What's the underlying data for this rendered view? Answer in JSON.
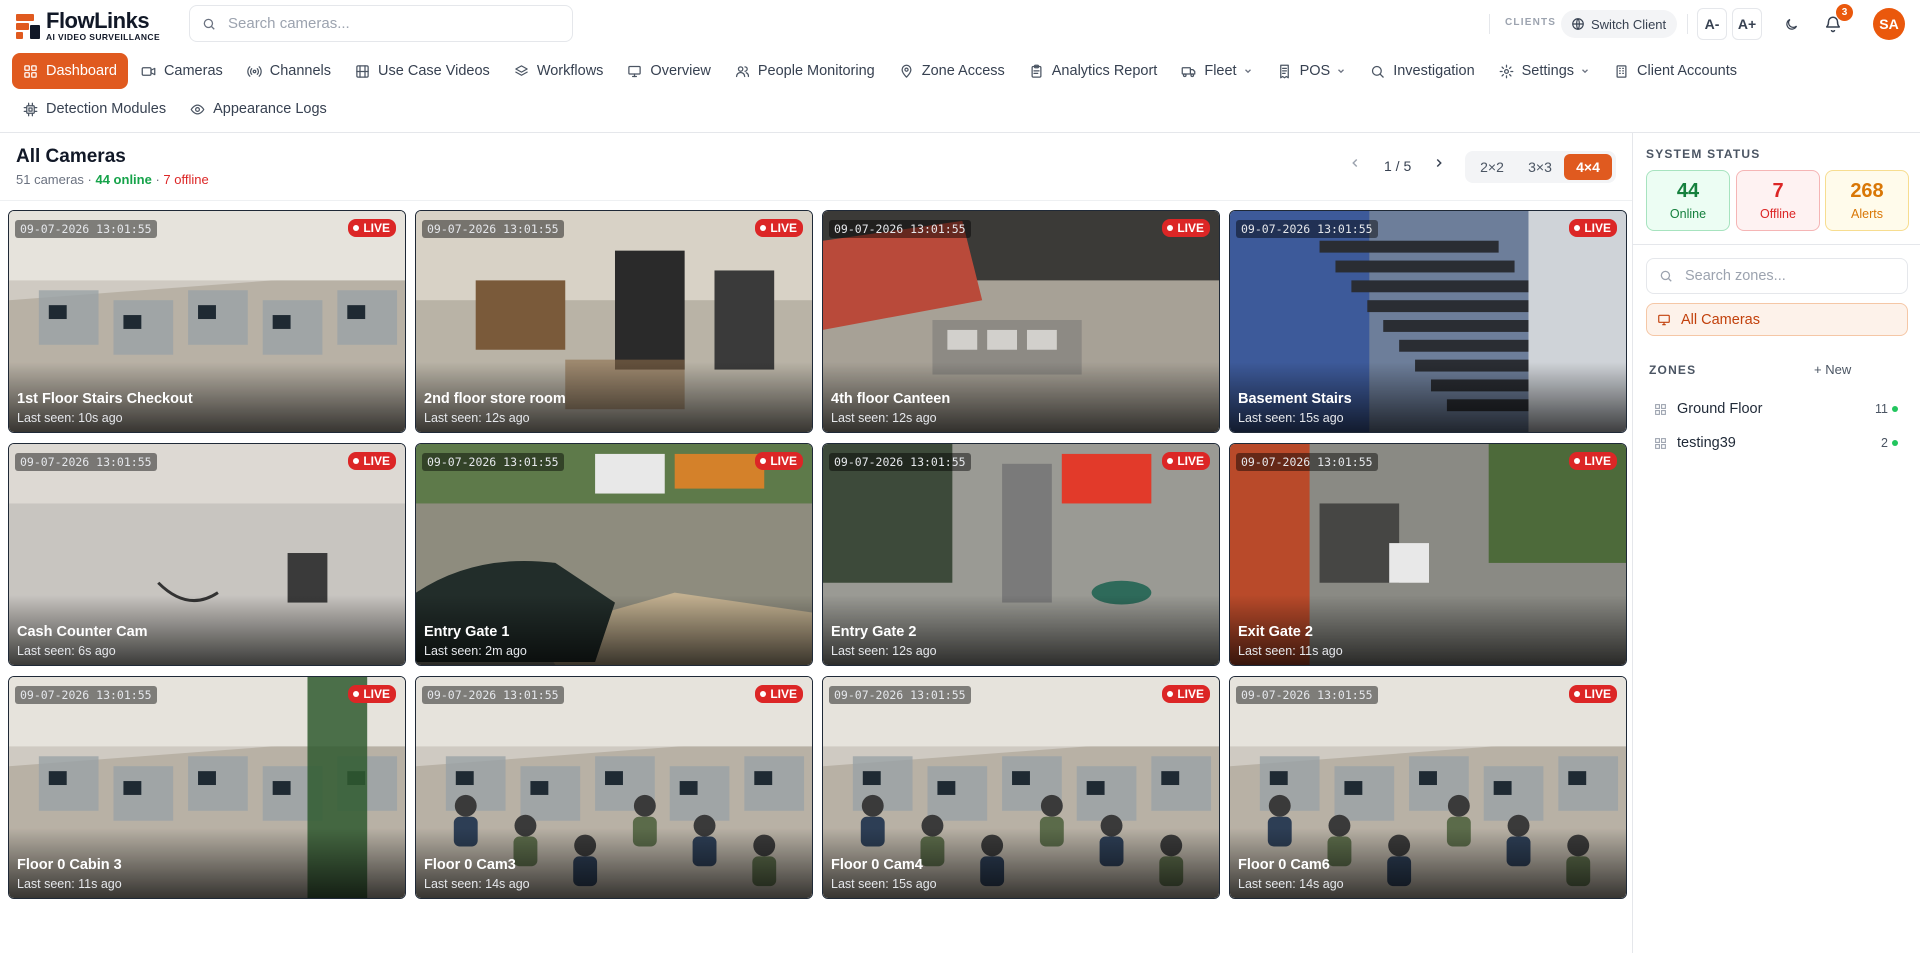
{
  "app": {
    "name": "FlowLinks",
    "tagline": "AI VIDEO SURVEILLANCE",
    "search_placeholder": "Search cameras...",
    "clients_label": "CLIENTS",
    "switch_client_label": "Switch Client",
    "font_decrease": "A-",
    "font_increase": "A+",
    "notification_count": "3",
    "user_initials": "SA",
    "accent_color": "#e05a1f"
  },
  "nav": {
    "row1": [
      {
        "label": "Dashboard",
        "icon": "grid-icon",
        "active": true
      },
      {
        "label": "Cameras",
        "icon": "video-icon"
      },
      {
        "label": "Channels",
        "icon": "broadcast-icon"
      },
      {
        "label": "Use Case Videos",
        "icon": "film-icon"
      },
      {
        "label": "Workflows",
        "icon": "layers-icon"
      },
      {
        "label": "Overview",
        "icon": "monitor-icon"
      },
      {
        "label": "People Monitoring",
        "icon": "users-icon"
      },
      {
        "label": "Zone Access",
        "icon": "map-pin-icon"
      },
      {
        "label": "Analytics Report",
        "icon": "clipboard-icon"
      },
      {
        "label": "Fleet",
        "icon": "truck-icon",
        "dropdown": true
      },
      {
        "label": "POS",
        "icon": "receipt-icon",
        "dropdown": true
      },
      {
        "label": "Investigation",
        "icon": "search-icon"
      },
      {
        "label": "Settings",
        "icon": "gear-icon",
        "dropdown": true
      },
      {
        "label": "Client Accounts",
        "icon": "building-icon"
      }
    ],
    "row2": [
      {
        "label": "Detection Modules",
        "icon": "cpu-icon"
      },
      {
        "label": "Appearance Logs",
        "icon": "eye-icon"
      }
    ]
  },
  "main": {
    "title": "All Cameras",
    "total": "51 cameras",
    "online": "44 online",
    "offline": "7 offline",
    "sep": " · ",
    "page": "1 / 5",
    "grid_options": [
      "2×2",
      "3×3",
      "4×4"
    ],
    "grid_selected": "4×4"
  },
  "cameras": [
    {
      "name": "1st Floor Stairs Checkout",
      "last_seen": "Last seen: 10s ago",
      "timestamp": "09-07-2026 13:01:55",
      "live": "LIVE",
      "scene": "office"
    },
    {
      "name": "2nd floor store room",
      "last_seen": "Last seen: 12s ago",
      "timestamp": "09-07-2026 13:01:55",
      "live": "LIVE",
      "scene": "store"
    },
    {
      "name": "4th floor Canteen",
      "last_seen": "Last seen: 12s ago",
      "timestamp": "09-07-2026 13:01:55",
      "live": "LIVE",
      "scene": "canteen"
    },
    {
      "name": "Basement Stairs",
      "last_seen": "Last seen: 15s ago",
      "timestamp": "09-07-2026 13:01:55",
      "live": "LIVE",
      "scene": "stairs"
    },
    {
      "name": "Cash Counter Cam",
      "last_seen": "Last seen: 6s ago",
      "timestamp": "09-07-2026 13:01:55",
      "live": "LIVE",
      "scene": "cash"
    },
    {
      "name": "Entry Gate 1",
      "last_seen": "Last seen: 2m ago",
      "timestamp": "09-07-2026 13:01:55",
      "live": "LIVE",
      "scene": "gate1"
    },
    {
      "name": "Entry Gate 2",
      "last_seen": "Last seen: 12s ago",
      "timestamp": "09-07-2026 13:01:55",
      "live": "LIVE",
      "scene": "gate2"
    },
    {
      "name": "Exit Gate 2",
      "last_seen": "Last seen: 11s ago",
      "timestamp": "09-07-2026 13:01:55",
      "live": "LIVE",
      "scene": "exit"
    },
    {
      "name": "Floor 0 Cabin 3",
      "last_seen": "Last seen: 11s ago",
      "timestamp": "09-07-2026 13:01:55",
      "live": "LIVE",
      "scene": "cabin"
    },
    {
      "name": "Floor 0 Cam3",
      "last_seen": "Last seen: 14s ago",
      "timestamp": "09-07-2026 13:01:55",
      "live": "LIVE",
      "scene": "people"
    },
    {
      "name": "Floor 0 Cam4",
      "last_seen": "Last seen: 15s ago",
      "timestamp": "09-07-2026 13:01:55",
      "live": "LIVE",
      "scene": "people"
    },
    {
      "name": "Floor 0 Cam6",
      "last_seen": "Last seen: 14s ago",
      "timestamp": "09-07-2026 13:01:55",
      "live": "LIVE",
      "scene": "people"
    }
  ],
  "sidebar": {
    "heading": "SYSTEM STATUS",
    "stats": {
      "online": {
        "value": "44",
        "label": "Online"
      },
      "offline": {
        "value": "7",
        "label": "Offline"
      },
      "alerts": {
        "value": "268",
        "label": "Alerts"
      }
    },
    "zone_search_placeholder": "Search zones...",
    "all_cameras_label": "All Cameras",
    "zones_heading": "ZONES",
    "new_label": "+ New",
    "zones": [
      {
        "name": "Ground Floor",
        "count": "11"
      },
      {
        "name": "testing39",
        "count": "2"
      }
    ]
  }
}
